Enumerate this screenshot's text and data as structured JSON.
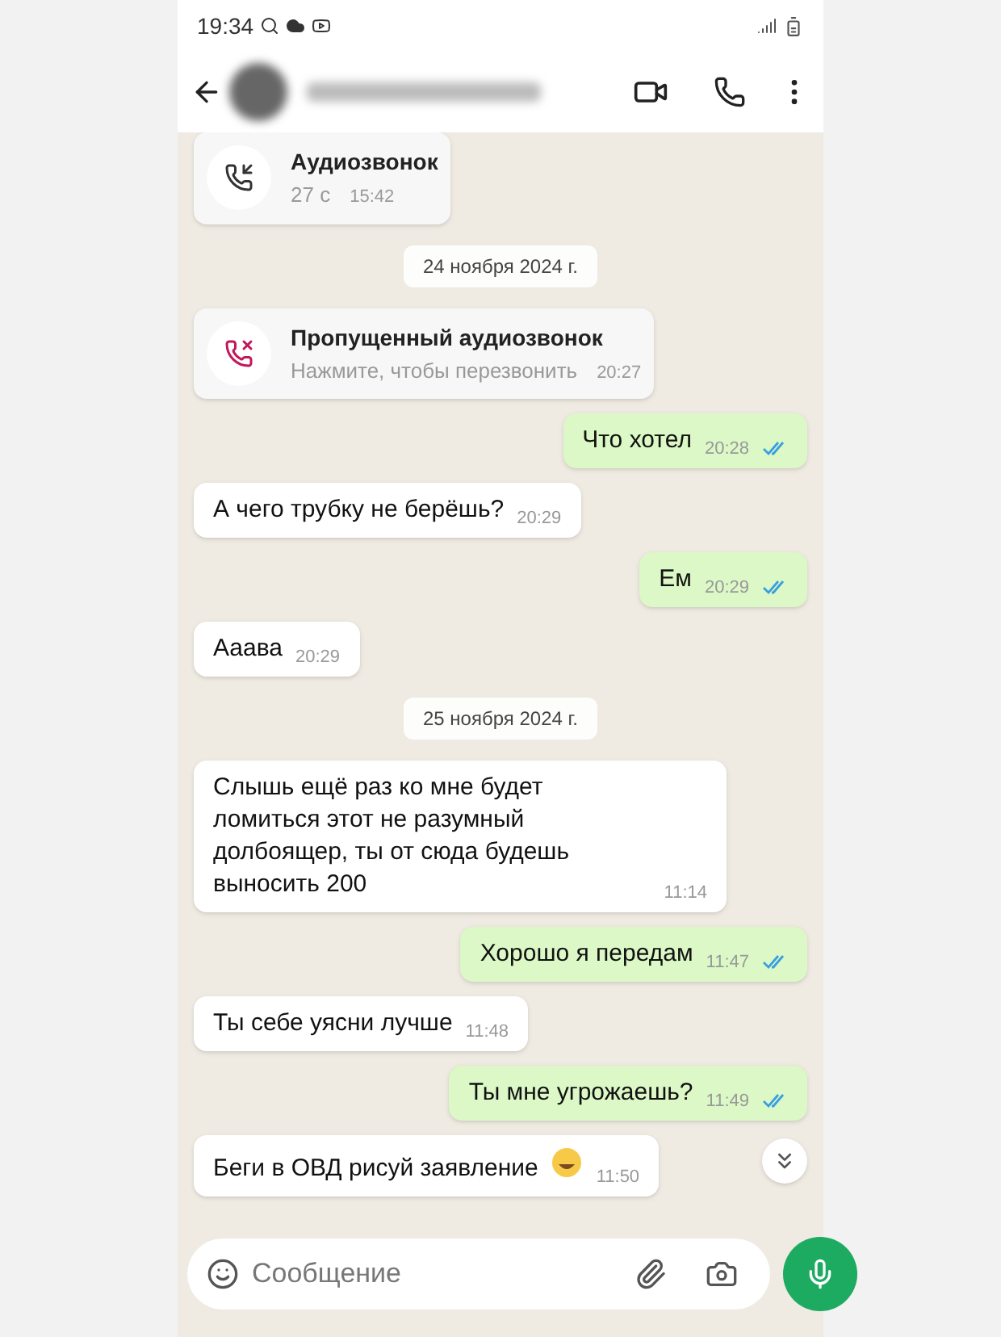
{
  "status_bar": {
    "time": "19:34"
  },
  "messages": [
    {
      "kind": "call",
      "title": "Аудиозвонок",
      "subtitle": "27 с",
      "time": "15:42"
    },
    {
      "kind": "date",
      "text": "24 ноября 2024 г."
    },
    {
      "kind": "missed_call",
      "title": "Пропущенный аудиозвонок",
      "subtitle": "Нажмите, чтобы перезвонить",
      "time": "20:27"
    },
    {
      "kind": "out",
      "text": "Что хотел",
      "time": "20:28",
      "read": true
    },
    {
      "kind": "in",
      "text": "А чего трубку не берёшь?",
      "time": "20:29"
    },
    {
      "kind": "out",
      "text": "Ем",
      "time": "20:29",
      "read": true
    },
    {
      "kind": "in",
      "text": "Ааава",
      "time": "20:29"
    },
    {
      "kind": "date",
      "text": "25 ноября 2024 г."
    },
    {
      "kind": "in",
      "text": "Слышь ещё раз ко мне будет ломиться этот не разумный долбоящер, ты от сюда будешь выносить 200",
      "time": "11:14"
    },
    {
      "kind": "out",
      "text": "Хорошо я передам",
      "time": "11:47",
      "read": true
    },
    {
      "kind": "in",
      "text": "Ты себе уясни лучше",
      "time": "11:48"
    },
    {
      "kind": "out",
      "text": "Ты мне угрожаешь?",
      "time": "11:49",
      "read": true
    },
    {
      "kind": "in",
      "text": "Беги в ОВД рисуй заявление",
      "emoji": true,
      "time": "11:50"
    }
  ],
  "composer": {
    "placeholder": "Сообщение"
  }
}
